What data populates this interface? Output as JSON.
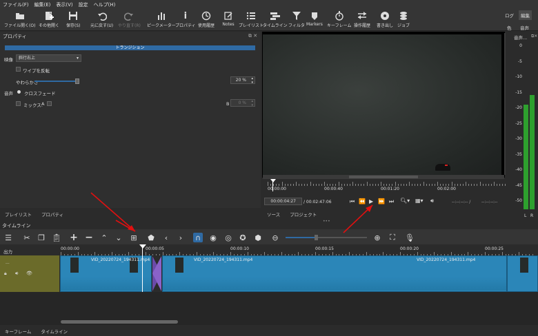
{
  "menu": [
    "ファイル(F)",
    "編集(E)",
    "表示(V)",
    "設定",
    "ヘルプ(H)"
  ],
  "toolbar": [
    {
      "label": "ファイル開く(O)",
      "icon": "folder-icon"
    },
    {
      "label": "その他開く",
      "icon": "open-other-icon"
    },
    {
      "label": "保存(S)",
      "icon": "save-icon"
    },
    {
      "label": "元に戻す(U)",
      "icon": "undo-icon"
    },
    {
      "label": "やり直す(R)",
      "icon": "redo-icon"
    },
    {
      "label": "ピークメーター",
      "icon": "peak-meter-icon"
    },
    {
      "label": "プロパティ",
      "icon": "info-icon"
    },
    {
      "label": "使用履歴",
      "icon": "history-icon"
    },
    {
      "label": "Notes",
      "icon": "notes-icon"
    },
    {
      "label": "プレイリスト",
      "icon": "playlist-icon"
    },
    {
      "label": "タイムライン",
      "icon": "timeline-icon"
    },
    {
      "label": "フィルタ",
      "icon": "filter-icon"
    },
    {
      "label": "Markers",
      "icon": "markers-icon"
    },
    {
      "label": "キーフレーム",
      "icon": "stopwatch-icon"
    },
    {
      "label": "操作履歴",
      "icon": "history-tree-icon"
    },
    {
      "label": "書き出し",
      "icon": "export-icon"
    },
    {
      "label": "ジョブ",
      "icon": "jobs-icon"
    }
  ],
  "layout_tabs": {
    "log": "ログ",
    "edit": "編集",
    "color": "色",
    "audio": "音声"
  },
  "properties": {
    "title": "プロパティ",
    "header": "トランジション",
    "video_label": "映像",
    "video_value": "斜行右上",
    "invert": "ワイプを反転",
    "softness_label": "やわらかさ",
    "softness_value": "20 %",
    "softness_fraction": 0.2,
    "audio_label": "音声",
    "crossfade": "クロスフェード",
    "mix_label": "ミックス:",
    "mix_a": "A",
    "mix_b": "B",
    "mix_value": "0 %"
  },
  "left_tabs": [
    "プレイリスト",
    "プロパティ"
  ],
  "player": {
    "ruler_labels": [
      "00:00:00",
      "00:00:40",
      "00:01:20",
      "00:02:00"
    ],
    "current_time": "00:00:04:27",
    "duration": "/ 00:02:47:06",
    "in_point": "--:--:--:-- /",
    "out_point": "--:--:--:--",
    "tabs": [
      "ソース",
      "プロジェクト"
    ]
  },
  "meter": {
    "title": "音声...",
    "scale": [
      "0",
      "-5",
      "-10",
      "-15",
      "-20",
      "-25",
      "-30",
      "-35",
      "-40",
      "-45",
      "-50"
    ],
    "channels": [
      "L",
      "R"
    ],
    "level_left_db": -19,
    "level_right_db": -16
  },
  "timeline": {
    "title": "タイムライン",
    "output_label": "出力",
    "track_dots": "...",
    "ruler": [
      "00:00:00",
      "00:00:05",
      "00:00:10",
      "00:00:15",
      "00:00:20",
      "00:00:25"
    ],
    "clips": [
      "VID_20220724_194311.mp4",
      "VID_20220724_194311.mp4",
      "VID_20220724_194311.mp4"
    ]
  },
  "bottom_tabs": [
    "キーフレーム",
    "タイムライン"
  ]
}
